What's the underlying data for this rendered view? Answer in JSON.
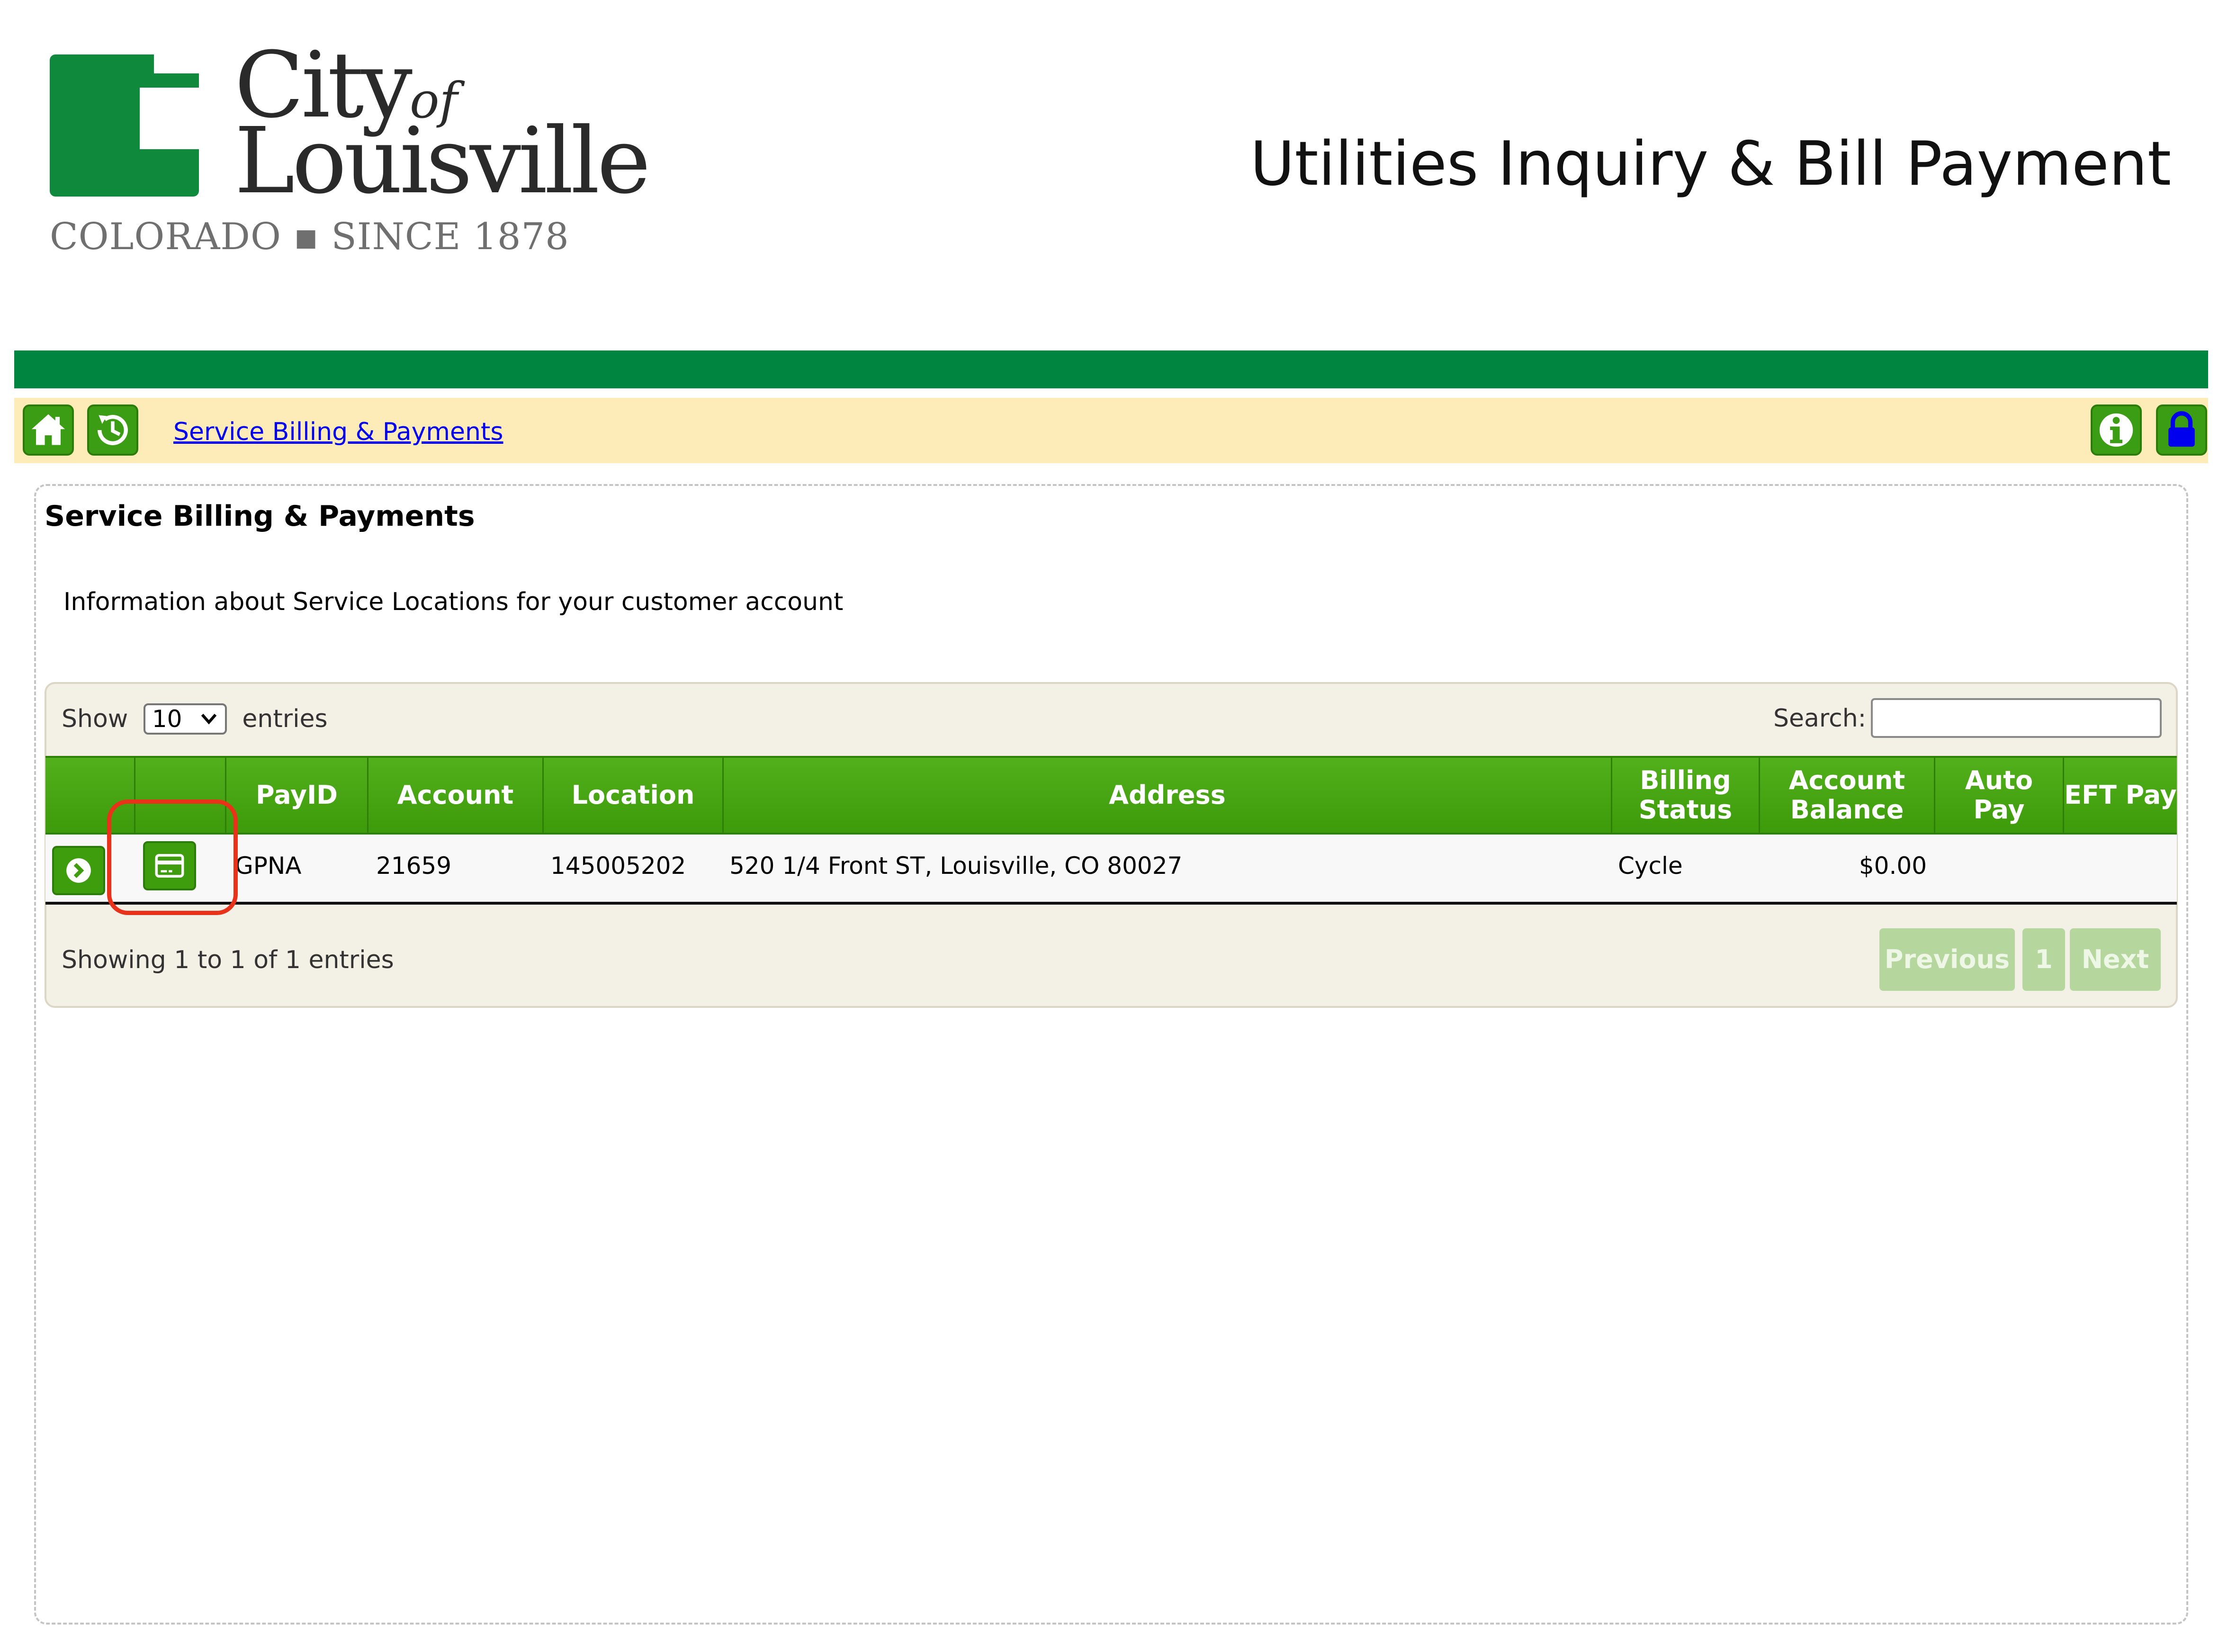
{
  "logo": {
    "line1": "City",
    "of": "of",
    "line2": "Louisville",
    "tagline": "COLORADO ▪ SINCE 1878"
  },
  "header": {
    "title": "Utilities Inquiry & Bill Payment"
  },
  "colors": {
    "brand_green": "#008540",
    "nav_background": "#fdebb8",
    "button_green": "#3d9d0d",
    "highlight": "#e8321a",
    "lock_blue": "#0000ee"
  },
  "nav": {
    "home_icon": "home-icon",
    "history_icon": "history-icon",
    "breadcrumb": "Service Billing & Payments",
    "info_icon": "info-icon",
    "lock_icon": "lock-icon"
  },
  "panel": {
    "title": "Service Billing & Payments",
    "description": "Information about Service Locations for your customer account"
  },
  "table": {
    "length_prefix": "Show",
    "length_value": "10",
    "length_suffix": "entries",
    "search_label": "Search:",
    "search_value": "",
    "columns": {
      "payid": "PayID",
      "account": "Account",
      "location": "Location",
      "address": "Address",
      "billing_status": "Billing Status",
      "account_balance": "Account Balance",
      "auto_pay": "Auto Pay",
      "eft_pay": "EFT Pay"
    },
    "rows": [
      {
        "payid": "GPNA",
        "account": "21659",
        "location": "145005202",
        "address": "520 1/4 Front ST, Louisville, CO 80027",
        "billing_status": "Cycle",
        "account_balance": "$0.00",
        "auto_pay": "",
        "eft_pay": ""
      }
    ],
    "info": "Showing 1 to 1 of 1 entries",
    "pagination": {
      "previous": "Previous",
      "page": "1",
      "next": "Next"
    }
  }
}
